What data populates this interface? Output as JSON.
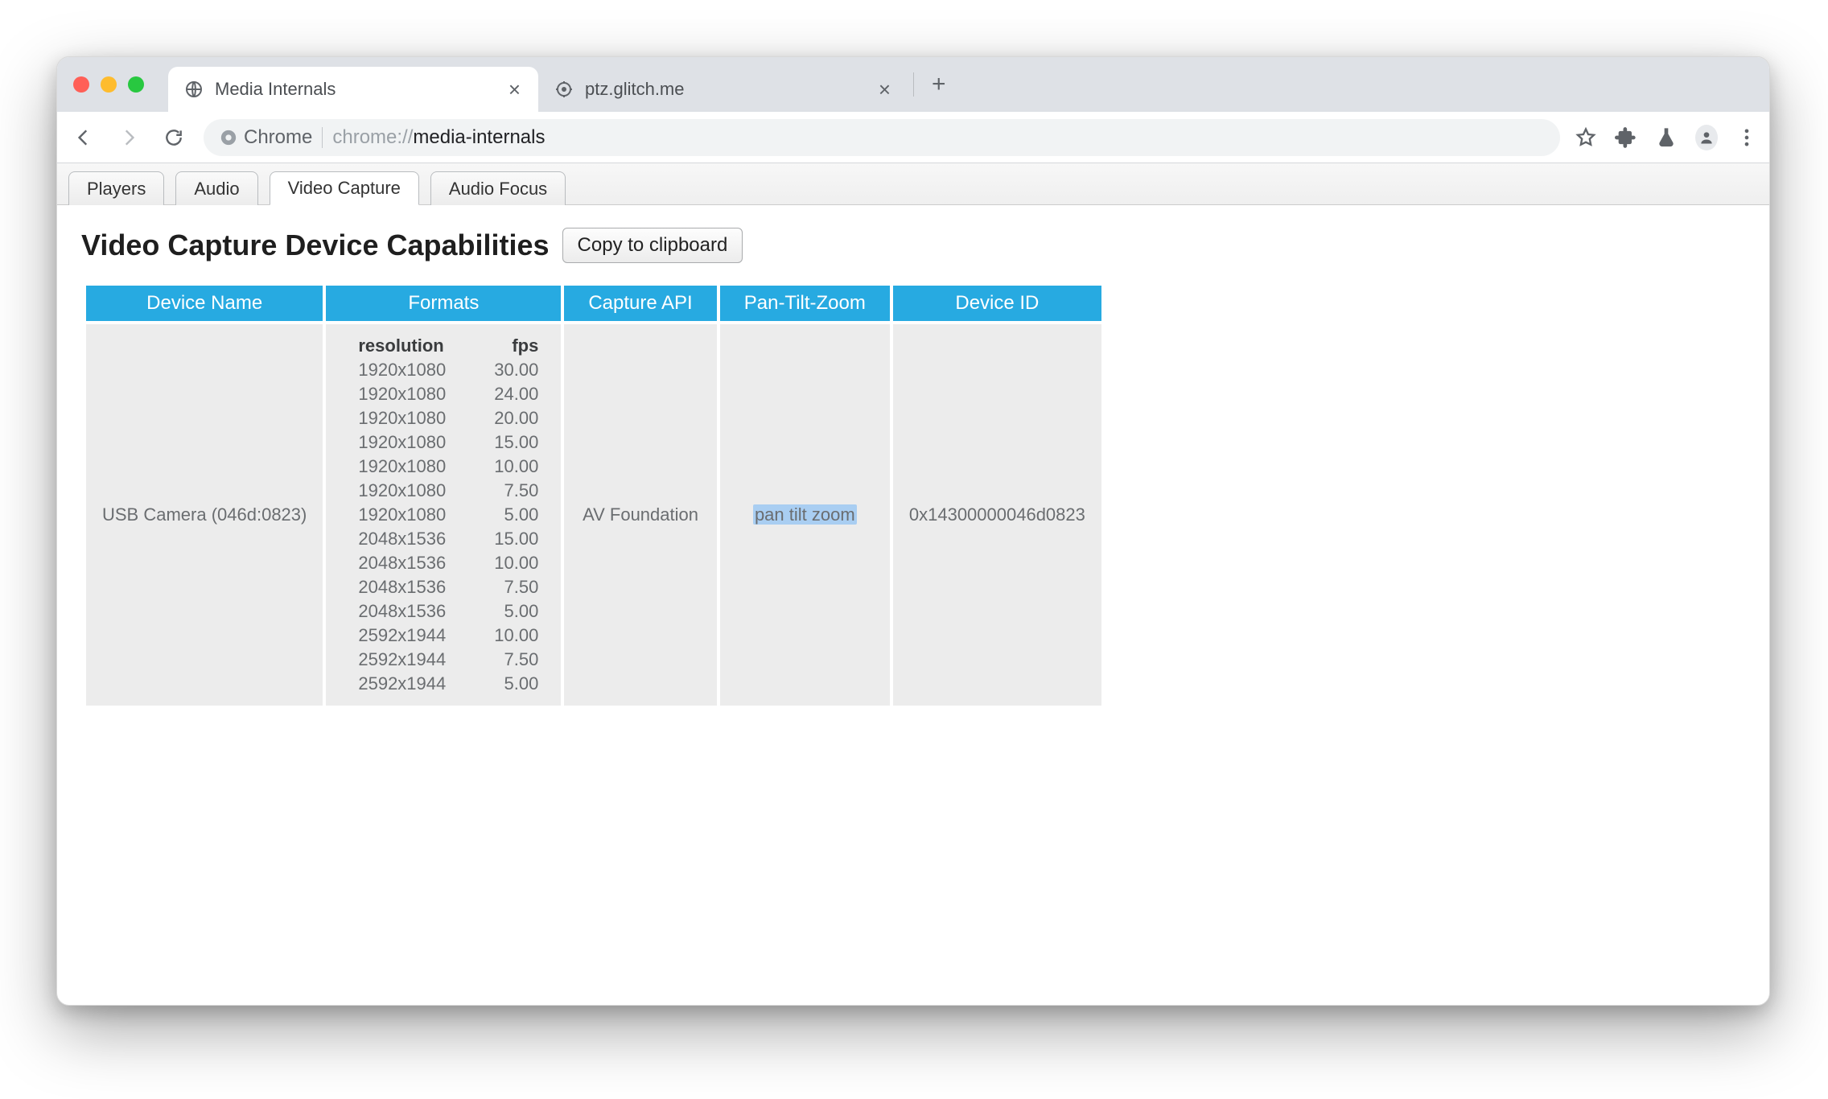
{
  "browser": {
    "tabs": [
      {
        "title": "Media Internals",
        "active": true,
        "favicon": "globe-icon"
      },
      {
        "title": "ptz.glitch.me",
        "active": false,
        "favicon": "target-icon"
      }
    ],
    "omnibox_chip": "Chrome",
    "omnibox_url_prefix": "chrome://",
    "omnibox_url_main": "media-internals"
  },
  "subtabs": {
    "items": [
      "Players",
      "Audio",
      "Video Capture",
      "Audio Focus"
    ],
    "active_index": 2
  },
  "content": {
    "heading": "Video Capture Device Capabilities",
    "copy_button": "Copy to clipboard",
    "table": {
      "headers": [
        "Device Name",
        "Formats",
        "Capture API",
        "Pan-Tilt-Zoom",
        "Device ID"
      ],
      "formats_headers": {
        "resolution": "resolution",
        "fps": "fps"
      },
      "row": {
        "device_name": "USB Camera (046d:0823)",
        "capture_api": "AV Foundation",
        "ptz": "pan tilt zoom",
        "device_id": "0x14300000046d0823",
        "formats": [
          {
            "resolution": "1920x1080",
            "fps": "30.00"
          },
          {
            "resolution": "1920x1080",
            "fps": "24.00"
          },
          {
            "resolution": "1920x1080",
            "fps": "20.00"
          },
          {
            "resolution": "1920x1080",
            "fps": "15.00"
          },
          {
            "resolution": "1920x1080",
            "fps": "10.00"
          },
          {
            "resolution": "1920x1080",
            "fps": "7.50"
          },
          {
            "resolution": "1920x1080",
            "fps": "5.00"
          },
          {
            "resolution": "2048x1536",
            "fps": "15.00"
          },
          {
            "resolution": "2048x1536",
            "fps": "10.00"
          },
          {
            "resolution": "2048x1536",
            "fps": "7.50"
          },
          {
            "resolution": "2048x1536",
            "fps": "5.00"
          },
          {
            "resolution": "2592x1944",
            "fps": "10.00"
          },
          {
            "resolution": "2592x1944",
            "fps": "7.50"
          },
          {
            "resolution": "2592x1944",
            "fps": "5.00"
          }
        ]
      }
    }
  }
}
